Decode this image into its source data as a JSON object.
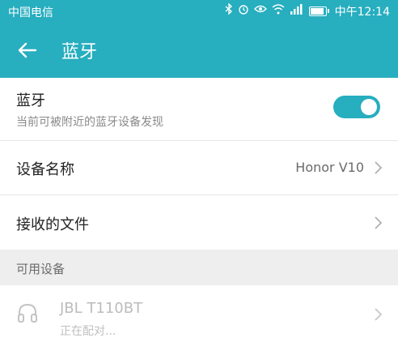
{
  "status_bar": {
    "carrier": "中国电信",
    "time": "中午12:14",
    "icons": [
      "bluetooth-icon",
      "alarm-icon",
      "eye-icon",
      "wifi-icon",
      "signal-icon",
      "battery-icon"
    ]
  },
  "toolbar": {
    "title": "蓝牙",
    "back_icon": "arrow-left-icon"
  },
  "bluetooth": {
    "title": "蓝牙",
    "subtitle": "当前可被附近的蓝牙设备发现",
    "enabled": true
  },
  "device_name": {
    "label": "设备名称",
    "value": "Honor V10"
  },
  "received_files": {
    "label": "接收的文件"
  },
  "available": {
    "header": "可用设备",
    "devices": [
      {
        "name": "JBL T110BT",
        "status": "正在配对...",
        "icon": "headphones-icon"
      }
    ]
  },
  "colors": {
    "accent": "#27aebf",
    "background": "#f4f4f4",
    "row_background": "#ffffff",
    "disabled_text": "#bcbcbc"
  }
}
